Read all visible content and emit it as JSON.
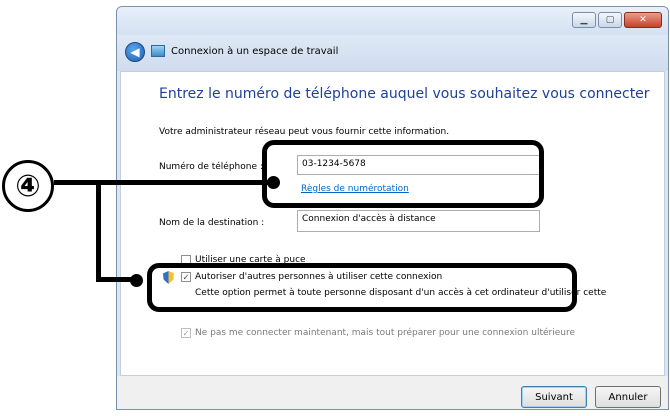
{
  "window": {
    "title": "Connexion à un espace de travail"
  },
  "main": {
    "heading": "Entrez le numéro de téléphone auquel vous souhaitez vous connecter",
    "info": "Votre administrateur réseau peut vous fournir cette information.",
    "phone_label": "Numéro de téléphone :",
    "phone_value": "03-1234-5678",
    "dialing_rules_link": "Règles de numérotation",
    "destination_label": "Nom de la destination :",
    "destination_value": "Connexion d'accès à distance",
    "smartcard_label": "Utiliser une carte à puce",
    "allow_others_label": "Autoriser d'autres personnes à utiliser cette connexion",
    "allow_others_desc": "Cette option permet à toute personne disposant d'un accès à cet ordinateur d'utiliser cette",
    "dont_connect_label": "Ne pas me connecter maintenant, mais tout préparer pour une connexion ultérieure"
  },
  "footer": {
    "next_label": "Suivant",
    "cancel_label": "Annuler"
  },
  "annotation": {
    "step_number": "④"
  },
  "colors": {
    "heading": "#1e3f9a",
    "link": "#0066cc",
    "callout": "#000000"
  },
  "icons": {
    "back": "back-arrow-icon",
    "app": "network-connection-icon",
    "shield": "uac-shield-icon"
  }
}
